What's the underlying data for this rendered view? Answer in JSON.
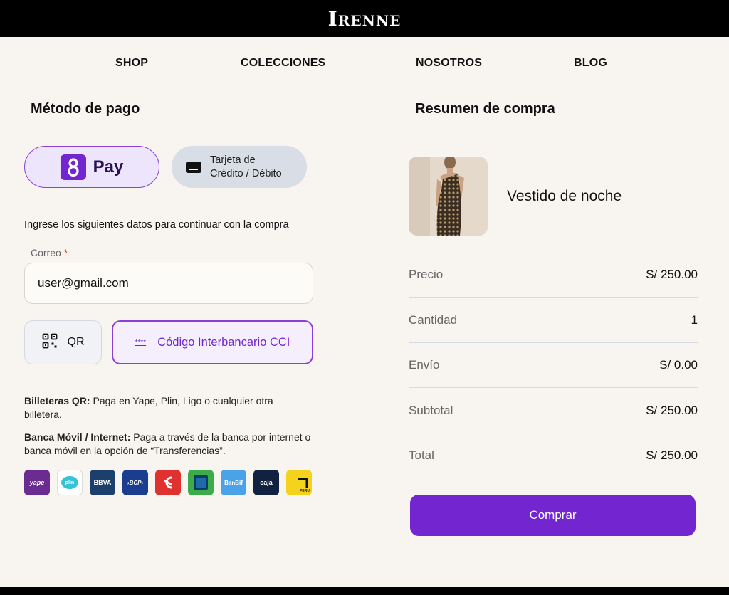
{
  "brand": "Irenne",
  "nav": {
    "items": [
      {
        "label": "SHOP"
      },
      {
        "label": "COLECCIONES"
      },
      {
        "label": "NOSOTROS"
      },
      {
        "label": "BLOG"
      }
    ]
  },
  "payment": {
    "title": "Método de pago",
    "methods": {
      "pay_label": "Pay",
      "card_label_line1": "Tarjeta de",
      "card_label_line2": "Crédito / Débito"
    },
    "instruction": "Ingrese los siguientes datos para continuar con la compra",
    "email": {
      "label": "Correo",
      "required_mark": "*",
      "value": "user@gmail.com"
    },
    "transfer": {
      "qr_label": "QR",
      "cci_stars": "****",
      "cci_label": "Código Interbancario CCI"
    },
    "info": {
      "wallets_bold": "Billeteras QR:",
      "wallets_text": " Paga en Yape, Plin, Ligo o cualquier otra billetera.",
      "bank_bold": "Banca Móvil / Internet:",
      "bank_text": " Paga a través de la banca por internet o banca móvil en la opción de “Transferencias”."
    },
    "banks": [
      {
        "name": "yape",
        "label": "yape",
        "color": "#6b2c91"
      },
      {
        "name": "plin",
        "label": "plin",
        "color": "#ffffff"
      },
      {
        "name": "bbva",
        "label": "BBVA",
        "color": "#1c3f6e"
      },
      {
        "name": "bcp",
        "label": "›BCP›",
        "color": "#1b3d8f"
      },
      {
        "name": "scotiabank",
        "label": "",
        "color": "#e03131"
      },
      {
        "name": "interbank",
        "label": "",
        "color": "#3cab4a"
      },
      {
        "name": "banbif",
        "label": "BanBif",
        "color": "#4aa3e8"
      },
      {
        "name": "caja",
        "label": "caja",
        "color": "#102240"
      },
      {
        "name": "pichincha",
        "label": "PERU",
        "color": "#f5d21c"
      }
    ]
  },
  "summary": {
    "title": "Resumen de compra",
    "product_name": "Vestido de noche",
    "rows": [
      {
        "label": "Precio",
        "value": "S/ 250.00"
      },
      {
        "label": "Cantidad",
        "value": "1"
      },
      {
        "label": "Envío",
        "value": "S/ 0.00"
      },
      {
        "label": "Subtotal",
        "value": "S/ 250.00"
      },
      {
        "label": "Total",
        "value": "S/ 250.00"
      }
    ],
    "buy_label": "Comprar"
  },
  "colors": {
    "accent": "#7326d0",
    "background": "#f8f4ef"
  }
}
